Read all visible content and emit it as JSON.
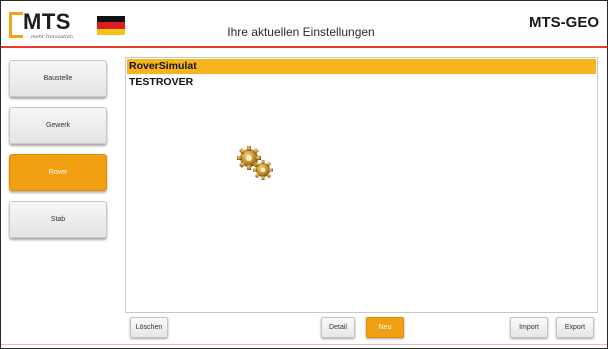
{
  "header": {
    "logo_text": "MTS",
    "logo_tagline": "mehr Innovation",
    "flag": {
      "colors": [
        "#111111",
        "#d81e1e",
        "#f3c315"
      ]
    },
    "title": "Ihre aktuellen Einstellungen",
    "brand": "MTS-GEO"
  },
  "sidebar": {
    "items": [
      {
        "label": "Baustelle",
        "active": false
      },
      {
        "label": "Gewerk",
        "active": false
      },
      {
        "label": "Rover",
        "active": true
      },
      {
        "label": "Stab",
        "active": false
      }
    ]
  },
  "list": {
    "items": [
      {
        "label": "RoverSimulat",
        "selected": true
      },
      {
        "label": "TESTROVER",
        "selected": false
      }
    ]
  },
  "loading_icon": "gears-loading-icon",
  "footer": {
    "delete_label": "Löschen",
    "detail_label": "Detail",
    "new_label": "Neu",
    "import_label": "Import",
    "export_label": "Export"
  },
  "colors": {
    "accent": "#f0a011",
    "selection": "#f6b51c",
    "header_line": "#e83b2c"
  }
}
